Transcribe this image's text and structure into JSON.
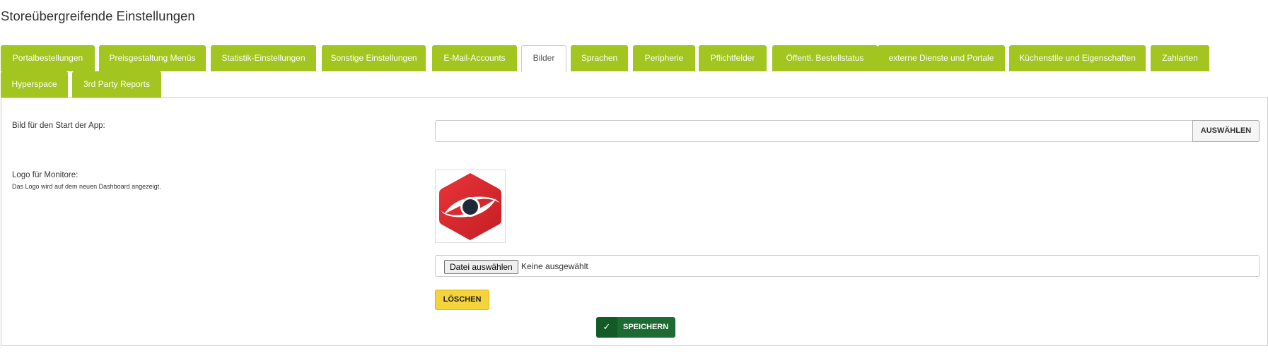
{
  "page": {
    "title": "Storeübergreifende Einstellungen"
  },
  "tabs": [
    {
      "label": "Portalbestellungen",
      "active": false
    },
    {
      "label": "Preisgestaltung Menüs",
      "active": false
    },
    {
      "label": "Statistik-Einstellungen",
      "active": false
    },
    {
      "label": "Sonstige Einstellungen",
      "active": false
    },
    {
      "label": "E-Mail-Accounts",
      "active": false
    },
    {
      "label": "Bilder",
      "active": true
    },
    {
      "label": "Sprachen",
      "active": false
    },
    {
      "label": "Peripherie",
      "active": false
    },
    {
      "label": "Pflichtfelder",
      "active": false
    },
    {
      "label": "Öffentl. Bestellstatus",
      "active": false
    },
    {
      "label": "externe Dienste und Portale",
      "active": false
    },
    {
      "label": "Küchenstile und Eigenschaften",
      "active": false
    },
    {
      "label": "Zahlarten",
      "active": false
    },
    {
      "label": "Hyperspace",
      "active": false
    },
    {
      "label": "3rd Party Reports",
      "active": false
    }
  ],
  "app_start_image": {
    "label": "Bild für den Start der App:",
    "value": "",
    "select_button": "AUSWÄHLEN"
  },
  "monitor_logo": {
    "label": "Logo für Monitore:",
    "help": "Das Logo wird auf dem neuen Dashboard angezeigt.",
    "file_button": "Datei auswählen",
    "file_status": "Keine ausgewählt",
    "delete_button": "LÖSCHEN"
  },
  "save_button": "SPEICHERN",
  "colors": {
    "tab_green": "#a2c520",
    "save_green": "#1d6b32",
    "delete_yellow": "#f5d33a",
    "logo_red": "#d8262b"
  },
  "icons": {
    "save": "check-icon"
  }
}
